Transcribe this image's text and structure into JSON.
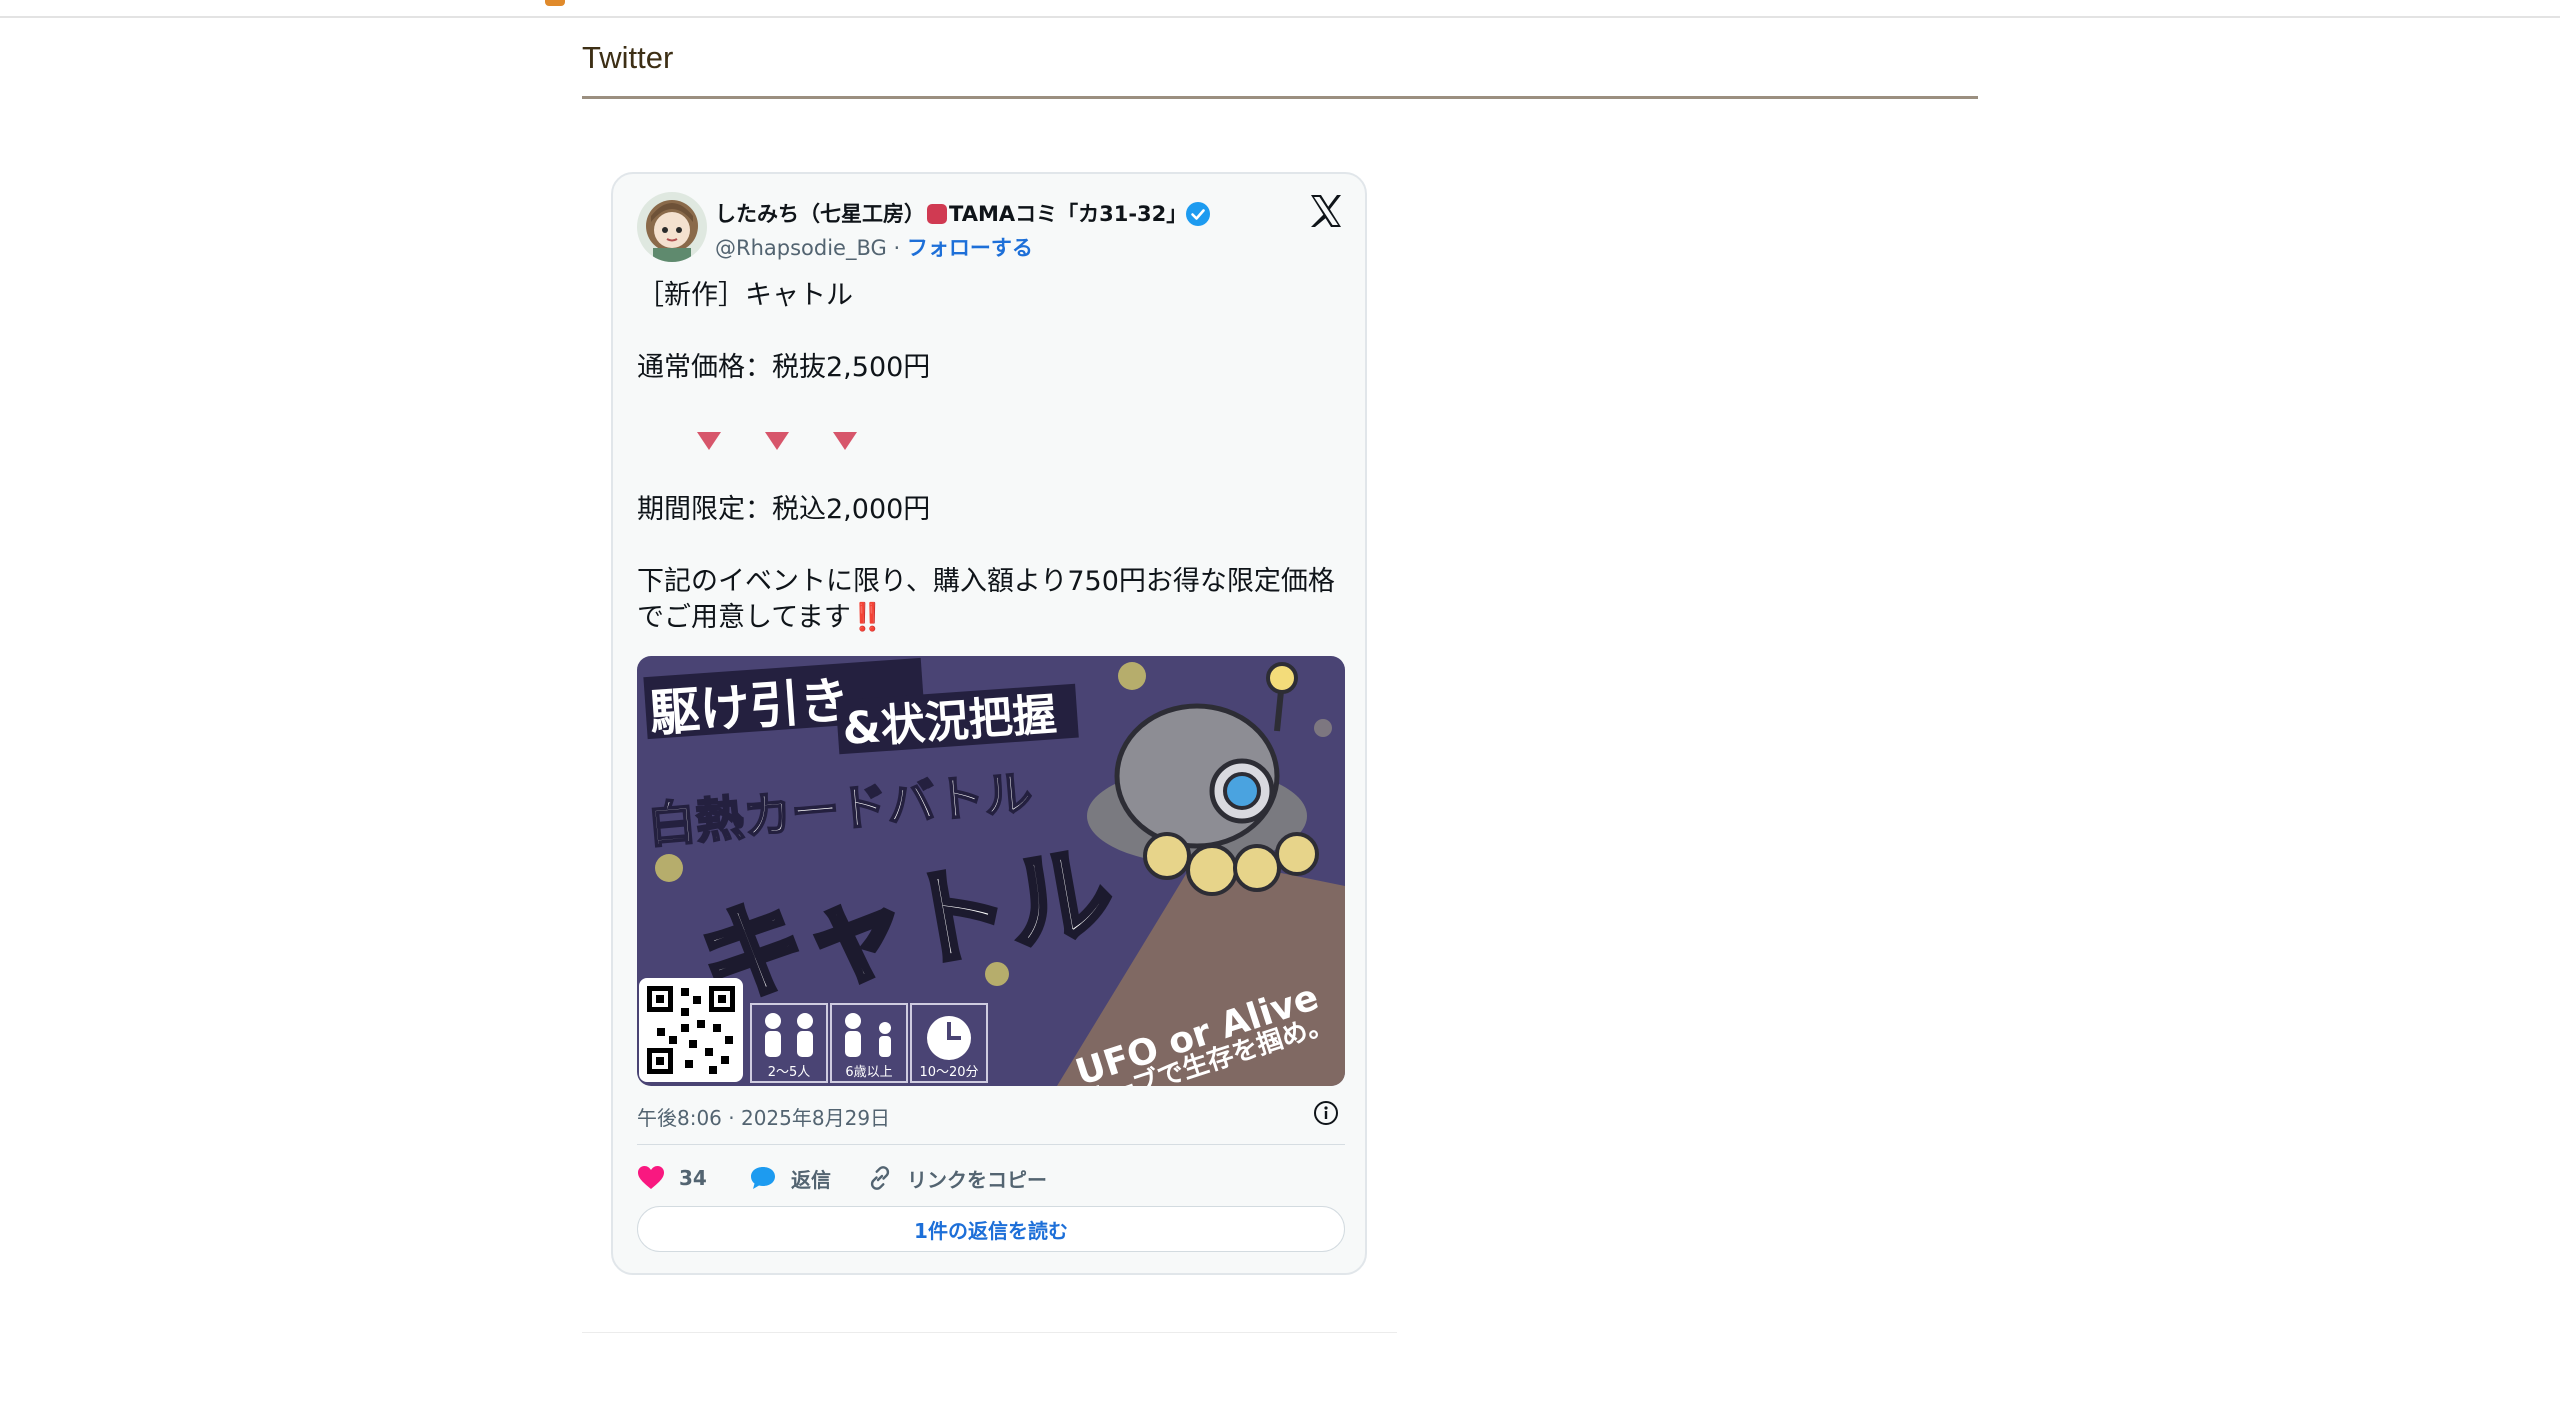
{
  "header": {
    "section_title": "Twitter"
  },
  "tweet": {
    "display_name": "したみち（七星工房）",
    "event_name": "TAMAコミ「カ31-32」",
    "handle": "@Rhapsodie_BG",
    "separator": "·",
    "follow_label": "フォローする",
    "text_lines": {
      "line1": "［新作］キャトル",
      "line2": "通常価格：税抜2,500円",
      "line3": "期間限定：税込2,000円",
      "line4": "下記のイベントに限り、購入額より750円お得な限定価格",
      "line5": "でご用意してます",
      "line5_emoji": "‼️"
    },
    "image": {
      "caption_line1": "駆け引き",
      "caption_line1b": "&状況把握",
      "caption_line2": "白熱カードバトル",
      "title": "キャトル",
      "subtitle_en": "UFO or Alive",
      "subtitle_jp": "オーブで生存を掴め。",
      "players": "2〜5人",
      "age": "6歳以上",
      "time": "10〜20分"
    },
    "timestamp": "午後8:06 · 2025年8月29日",
    "likes": "34",
    "reply_label": "返信",
    "copy_link_label": "リンクをコピー",
    "read_replies_label": "1件の返信を読む"
  },
  "colors": {
    "accent_blue": "#1d6fd8",
    "heart": "#f91880",
    "section_title": "#3d2f15",
    "image_bg": "#4a4474"
  },
  "icons": [
    "dice-icon",
    "verified-badge-icon",
    "x-logo-icon",
    "down-triangle-icon",
    "info-icon",
    "heart-icon",
    "reply-bubble-icon",
    "link-icon"
  ]
}
